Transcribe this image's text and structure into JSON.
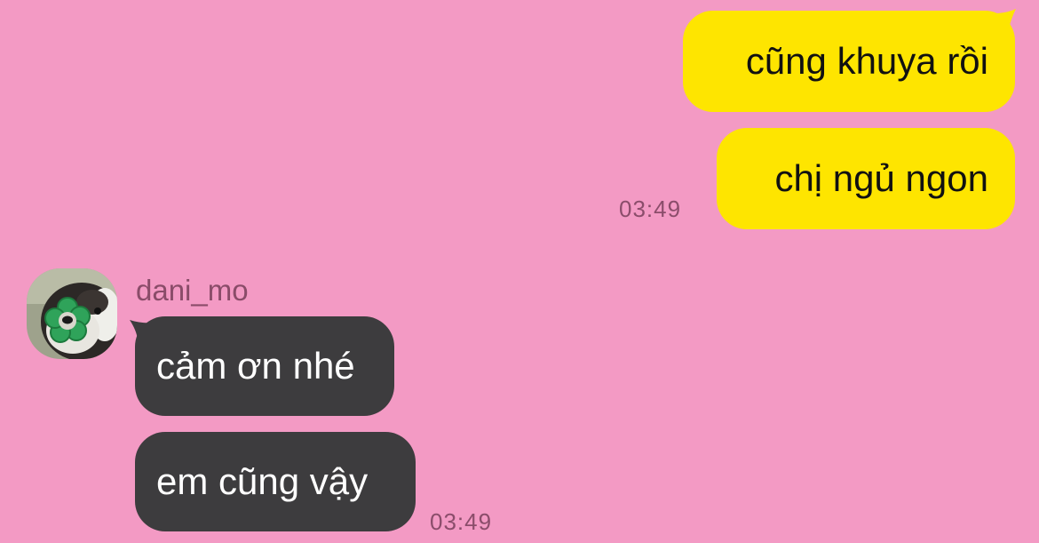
{
  "conversation": {
    "outgoing": {
      "messages": [
        {
          "text": "cũng khuya rồi"
        },
        {
          "text": "chị ngủ ngon"
        }
      ],
      "time": "03:49"
    },
    "incoming": {
      "sender": "dani_mo",
      "avatar_icon": "dog-with-flower-toy-avatar",
      "messages": [
        {
          "text": "cảm ơn nhé"
        },
        {
          "text": "em cũng vậy"
        }
      ],
      "time": "03:49"
    }
  },
  "colors": {
    "background": "#f39ac4",
    "outgoing_bubble": "#fee500",
    "incoming_bubble": "#3d3c3e",
    "timestamp": "#8b4d6b",
    "sender_name": "#8a4c69"
  }
}
